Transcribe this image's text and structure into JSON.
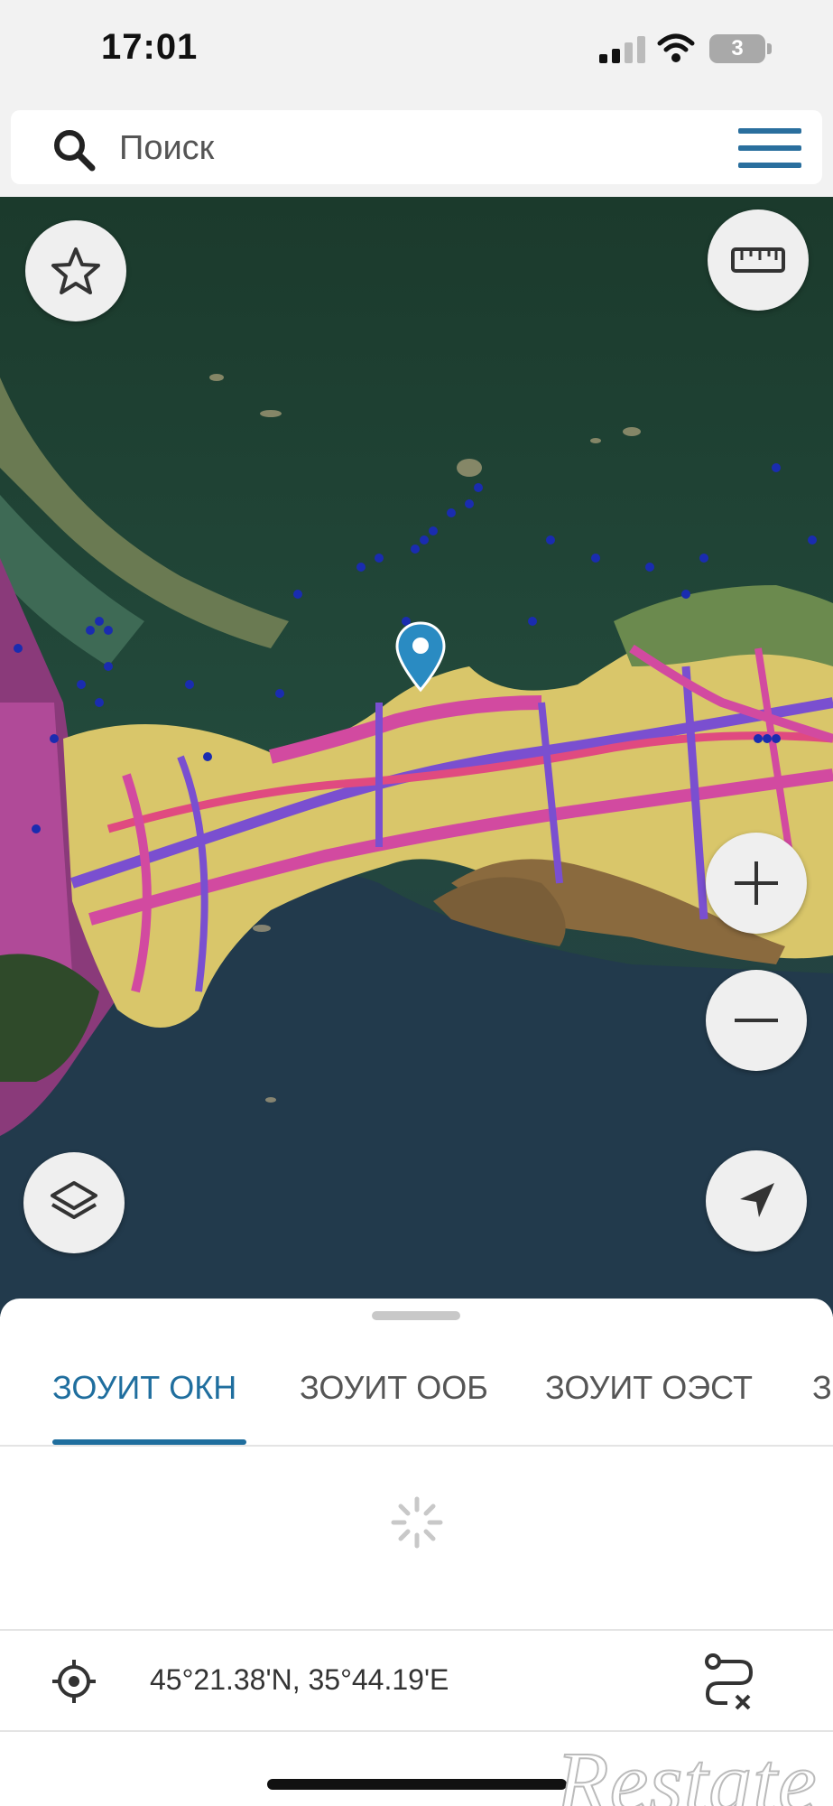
{
  "status_bar": {
    "time": "17:01",
    "battery": "3",
    "icons": [
      "signal-icon",
      "wifi-icon",
      "battery-icon"
    ]
  },
  "search": {
    "placeholder": "Поиск",
    "icons": [
      "search-icon",
      "menu-icon"
    ]
  },
  "map": {
    "controls": [
      "favorites-star-icon",
      "ruler-icon",
      "zoom-in-icon",
      "zoom-out-icon",
      "layers-icon",
      "locate-arrow-icon"
    ],
    "marker": "location-pin-icon"
  },
  "sheet": {
    "tabs": [
      {
        "label": "ЗОУИТ ОКН",
        "active": true
      },
      {
        "label": "ЗОУИТ ООБ",
        "active": false
      },
      {
        "label": "ЗОУИТ ОЭСТ",
        "active": false
      },
      {
        "label": "З",
        "active": false
      }
    ],
    "loading_icon": "spinner-icon",
    "coordinates": "45°21.38'N, 35°44.19'E",
    "route_icon": "route-clear-icon"
  },
  "watermark": "Restate",
  "colors": {
    "accent": "#1f6e9e",
    "pin": "#2a8bc2",
    "water": "#1d3d2f",
    "land": "#d9c66a",
    "zones_magenta": "#d24aa0",
    "zones_purple": "#7a4fd0"
  }
}
